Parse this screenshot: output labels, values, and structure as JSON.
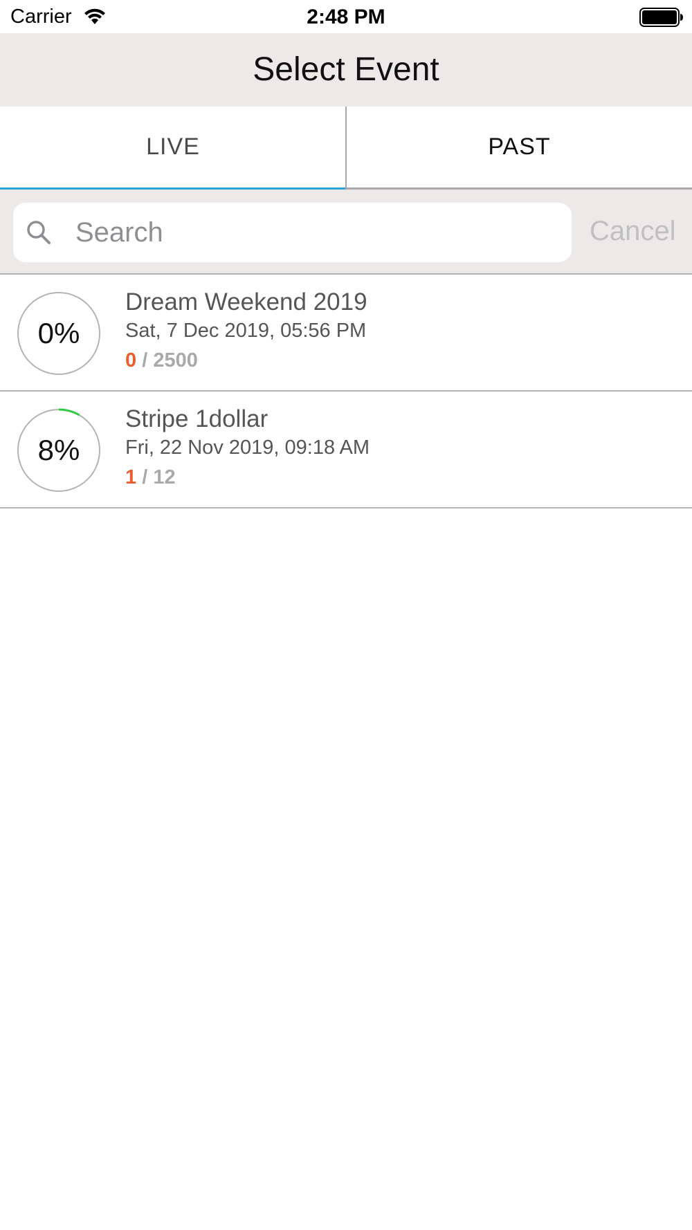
{
  "status_bar": {
    "carrier": "Carrier",
    "time": "2:48 PM"
  },
  "nav": {
    "title": "Select Event"
  },
  "tabs": [
    {
      "label": "LIVE",
      "active": true
    },
    {
      "label": "PAST",
      "active": false
    }
  ],
  "search": {
    "placeholder": "Search",
    "value": "",
    "cancel_label": "Cancel"
  },
  "colors": {
    "accent": "#2aa6d6",
    "progress": "#2ecc40",
    "checked_in": "#e95d2c",
    "nav_bg": "#ece9e8"
  },
  "events": [
    {
      "percent_label": "0%",
      "progress": 0.0,
      "title": "Dream Weekend 2019",
      "date": "Sat, 7 Dec 2019, 05:56 PM",
      "checked_in": "0",
      "separator": "/",
      "total": "2500"
    },
    {
      "percent_label": "8%",
      "progress": 0.0833,
      "title": "Stripe 1dollar",
      "date": "Fri, 22 Nov 2019, 09:18 AM",
      "checked_in": "1",
      "separator": "/",
      "total": "12"
    }
  ]
}
